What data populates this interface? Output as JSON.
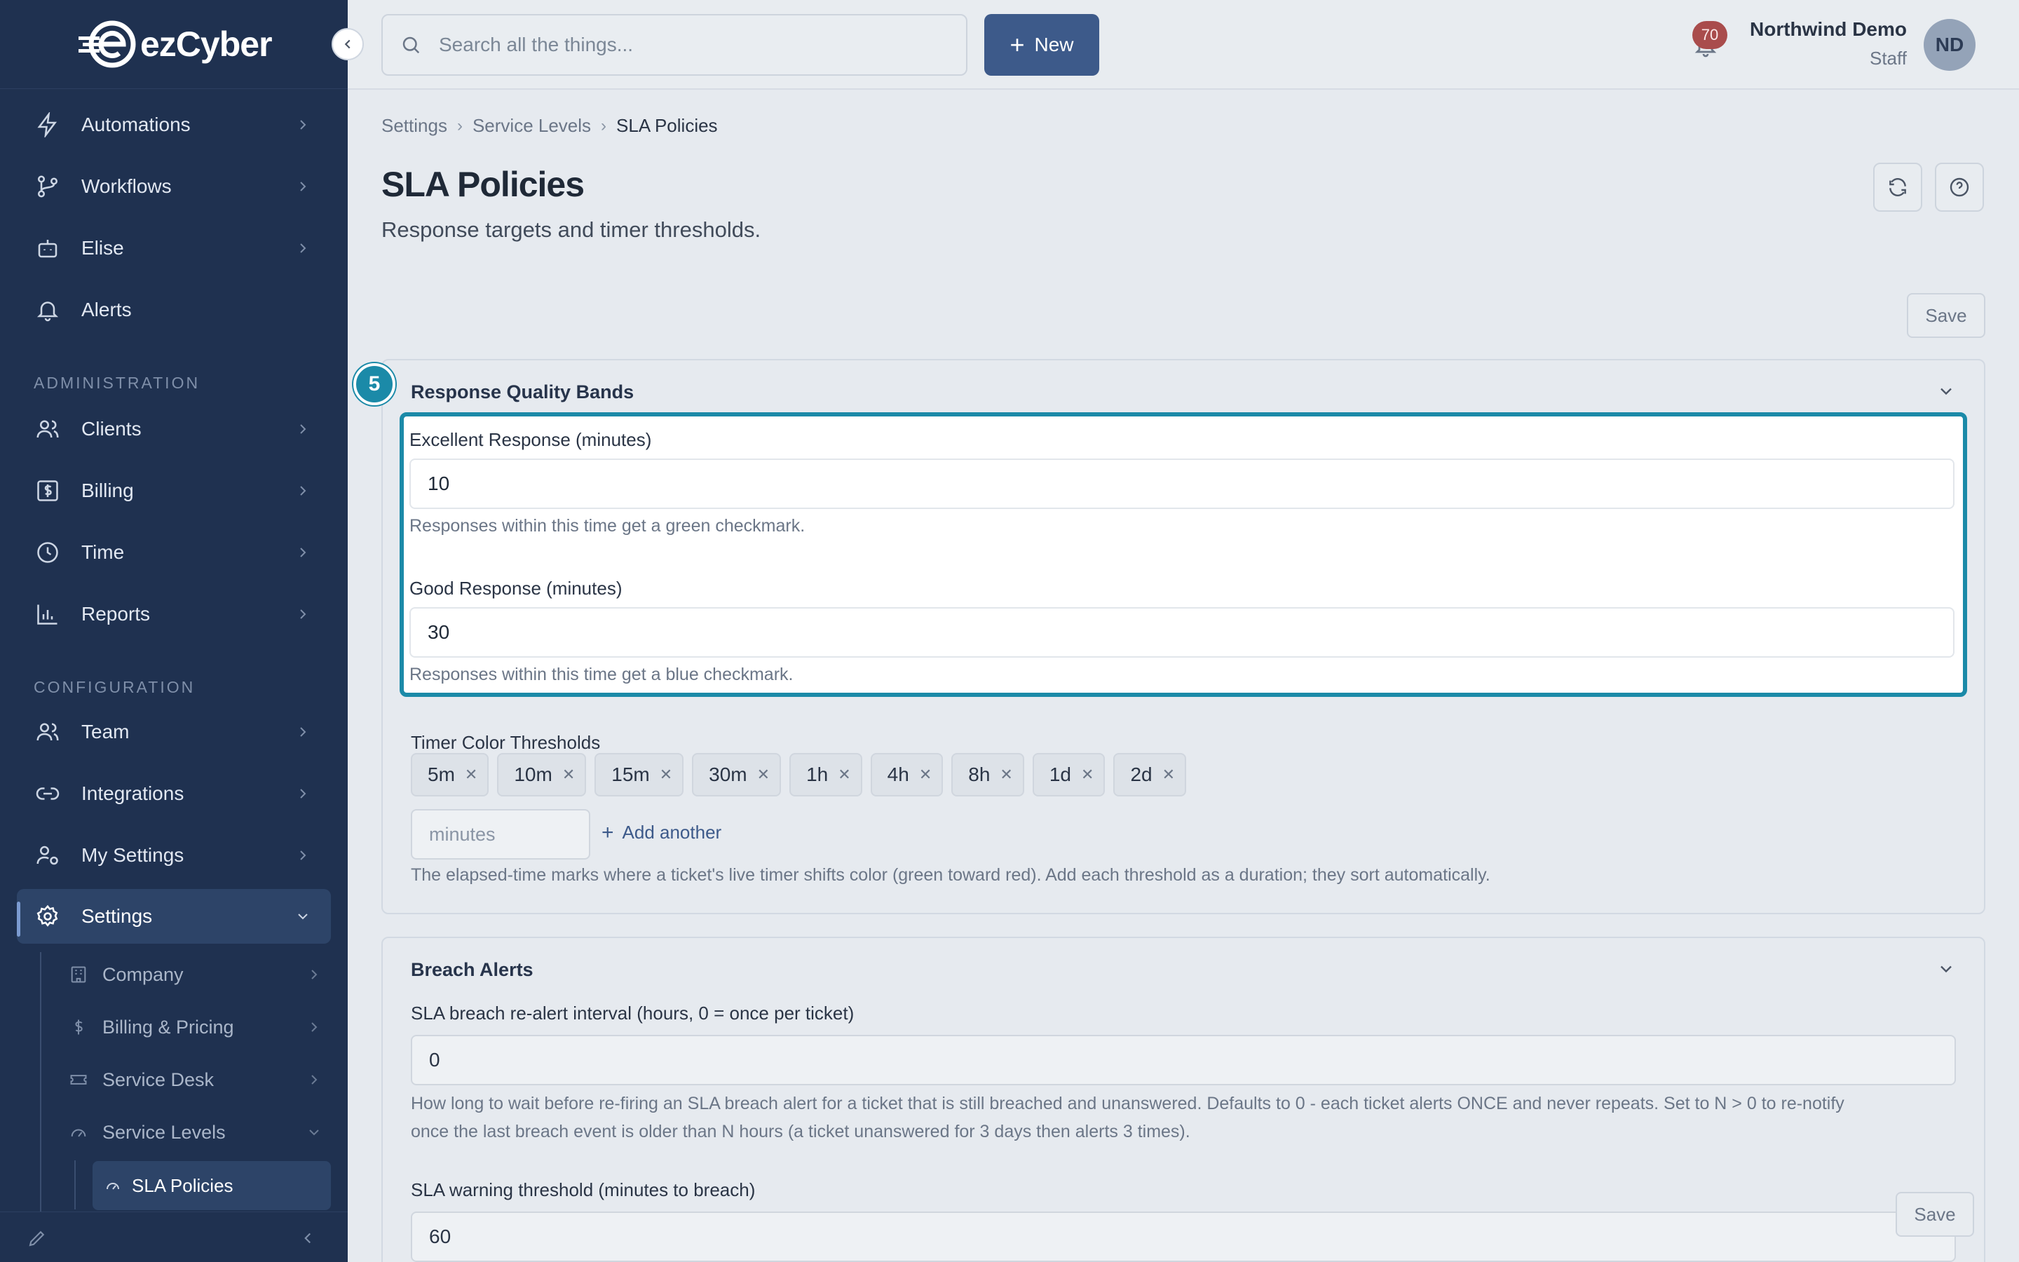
{
  "brand": {
    "name": "ezCyber",
    "accent": "#1b8aa8",
    "sidebar_bg": "#1f3150"
  },
  "sidebar": {
    "items": [
      {
        "label": "Automations",
        "icon": "lightning-icon"
      },
      {
        "label": "Workflows",
        "icon": "workflow-icon"
      },
      {
        "label": "Elise",
        "icon": "bot-icon"
      },
      {
        "label": "Alerts",
        "icon": "bell-icon"
      }
    ],
    "section_admin": "ADMINISTRATION",
    "admin_items": [
      {
        "label": "Clients",
        "icon": "users-icon"
      },
      {
        "label": "Billing",
        "icon": "dollar-icon"
      },
      {
        "label": "Time",
        "icon": "clock-icon"
      },
      {
        "label": "Reports",
        "icon": "bar-chart-icon"
      }
    ],
    "section_config": "CONFIGURATION",
    "config_items": [
      {
        "label": "Team",
        "icon": "team-icon"
      },
      {
        "label": "Integrations",
        "icon": "link-icon"
      },
      {
        "label": "My Settings",
        "icon": "user-cog-icon"
      },
      {
        "label": "Settings",
        "icon": "gear-icon"
      }
    ],
    "settings_children": [
      {
        "label": "Company",
        "icon": "building-icon"
      },
      {
        "label": "Billing & Pricing",
        "icon": "dollar-icon"
      },
      {
        "label": "Service Desk",
        "icon": "ticket-icon"
      },
      {
        "label": "Service Levels",
        "icon": "gauge-icon"
      }
    ],
    "active_leaf": "SLA Policies"
  },
  "topbar": {
    "search_placeholder": "Search all the things...",
    "new_label": "New",
    "notification_count": "70",
    "user_name": "Northwind Demo",
    "user_role": "Staff",
    "avatar_initials": "ND"
  },
  "breadcrumb": [
    "Settings",
    "Service Levels",
    "SLA Policies"
  ],
  "page": {
    "title": "SLA Policies",
    "subtitle": "Response targets and timer thresholds.",
    "save_label": "Save"
  },
  "step_badge": "5",
  "quality_bands": {
    "title": "Response Quality Bands",
    "excellent_label": "Excellent Response (minutes)",
    "excellent_value": "10",
    "excellent_help": "Responses within this time get a green checkmark.",
    "good_label": "Good Response (minutes)",
    "good_value": "30",
    "good_help": "Responses within this time get a blue checkmark.",
    "timer_label": "Timer Color Thresholds",
    "thresholds": [
      "5m",
      "10m",
      "15m",
      "30m",
      "1h",
      "4h",
      "8h",
      "1d",
      "2d"
    ],
    "minutes_placeholder": "minutes",
    "add_another": "Add another",
    "timer_help": "The elapsed-time marks where a ticket's live timer shifts color (green toward red). Add each threshold as a duration; they sort automatically."
  },
  "breach_alerts": {
    "title": "Breach Alerts",
    "realert_label": "SLA breach re-alert interval (hours, 0 = once per ticket)",
    "realert_value": "0",
    "realert_help_1": "How long to wait before re-firing an SLA breach alert for a ticket that is still breached and unanswered. Defaults to 0 - each ticket alerts ONCE and never repeats. Set to N > 0 to re-notify",
    "realert_help_2": "once the last breach event is older than N hours (a ticket unanswered for 3 days then alerts 3 times).",
    "warning_label": "SLA warning threshold (minutes to breach)",
    "warning_value": "60"
  }
}
